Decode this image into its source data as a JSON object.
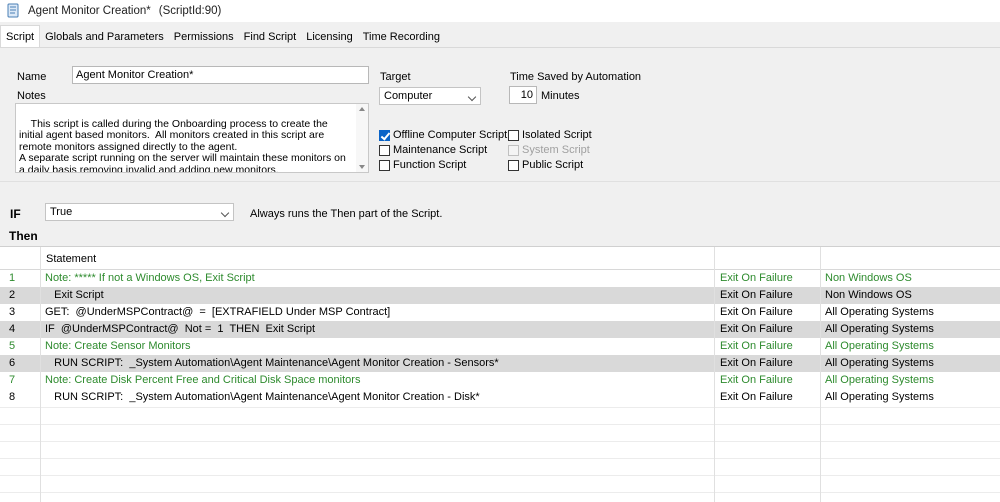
{
  "window": {
    "title": "Agent Monitor Creation*",
    "script_id": "(ScriptId:90)"
  },
  "tabs": [
    {
      "label": "Script",
      "active": true
    },
    {
      "label": "Globals and Parameters",
      "active": false
    },
    {
      "label": "Permissions",
      "active": false
    },
    {
      "label": "Find Script",
      "active": false
    },
    {
      "label": "Licensing",
      "active": false
    },
    {
      "label": "Time Recording",
      "active": false
    }
  ],
  "form": {
    "name_label": "Name",
    "name_value": "Agent Monitor Creation*",
    "notes_label": "Notes",
    "notes_value": "This script is called during the Onboarding process to create the initial agent based monitors.  All monitors created in this script are remote monitors assigned directly to the agent.\nA separate script running on the server will maintain these monitors on a daily basis removing invalid and adding new monitors.",
    "target_label": "Target",
    "target_value": "Computer",
    "time_saved_label": "Time Saved by Automation",
    "time_saved_value": "10",
    "time_saved_unit": "Minutes"
  },
  "checkboxes": {
    "offline": {
      "label": "Offline Computer Script",
      "checked": true
    },
    "maintenance": {
      "label": "Maintenance Script",
      "checked": false
    },
    "function": {
      "label": "Function Script",
      "checked": false
    },
    "isolated": {
      "label": "Isolated Script",
      "checked": false
    },
    "system": {
      "label": "System Script",
      "checked": false,
      "disabled": true
    },
    "public": {
      "label": "Public Script",
      "checked": false
    }
  },
  "logic": {
    "if_label": "IF",
    "if_value": "True",
    "if_description": "Always runs the Then part of the Script.",
    "then_label": "Then"
  },
  "grid": {
    "header": {
      "statement": "Statement"
    },
    "rows": [
      {
        "num": "1",
        "statement": "Note: ***** If not a Windows OS, Exit Script",
        "failure": "Exit On Failure",
        "os": "Non Windows OS",
        "style": "green"
      },
      {
        "num": "2",
        "statement": "   Exit Script",
        "failure": "Exit On Failure",
        "os": "Non Windows OS",
        "style": "shaded"
      },
      {
        "num": "3",
        "statement": "GET:  @UnderMSPContract@  =  [EXTRAFIELD Under MSP Contract]",
        "failure": "Exit On Failure",
        "os": "All Operating Systems",
        "style": "normal"
      },
      {
        "num": "4",
        "statement": "IF  @UnderMSPContract@  Not =  1  THEN  Exit Script",
        "failure": "Exit On Failure",
        "os": "All Operating Systems",
        "style": "shaded"
      },
      {
        "num": "5",
        "statement": "Note: Create Sensor Monitors",
        "failure": "Exit On Failure",
        "os": "All Operating Systems",
        "style": "green"
      },
      {
        "num": "6",
        "statement": "   RUN SCRIPT:  _System Automation\\Agent Maintenance\\Agent Monitor Creation - Sensors*",
        "failure": "Exit On Failure",
        "os": "All Operating Systems",
        "style": "shaded"
      },
      {
        "num": "7",
        "statement": "Note: Create Disk Percent Free and Critical Disk Space monitors",
        "failure": "Exit On Failure",
        "os": "All Operating Systems",
        "style": "green"
      },
      {
        "num": "8",
        "statement": "   RUN SCRIPT:  _System Automation\\Agent Maintenance\\Agent Monitor Creation - Disk*",
        "failure": "Exit On Failure",
        "os": "All Operating Systems",
        "style": "normal"
      }
    ]
  }
}
